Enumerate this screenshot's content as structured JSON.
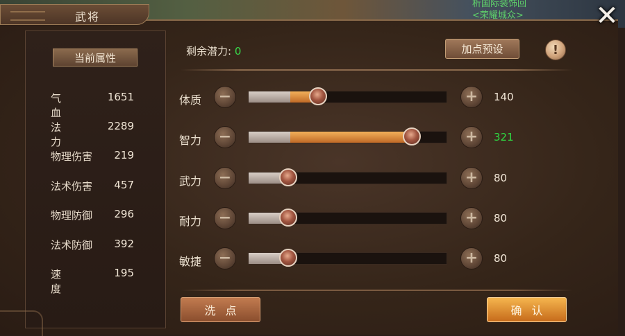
{
  "background": {
    "line1": "析国际装饰回",
    "line2": "<荣耀城众>"
  },
  "window": {
    "title": "武将"
  },
  "left": {
    "header": "当前属性",
    "stats": [
      {
        "label": "气血",
        "value": "1651"
      },
      {
        "label": "法力",
        "value": "2289"
      },
      {
        "label": "物理伤害",
        "value": "219"
      },
      {
        "label": "法术伤害",
        "value": "457"
      },
      {
        "label": "物理防御",
        "value": "296"
      },
      {
        "label": "法术防御",
        "value": "392"
      },
      {
        "label": "速度",
        "value": "195"
      }
    ]
  },
  "right": {
    "remaining_label": "剩余潜力:",
    "remaining_value": "0",
    "preset_button": "加点预设",
    "info_icon_glyph": "!",
    "minus_glyph": "−",
    "plus_glyph": "+",
    "sliders": [
      {
        "name": "体质",
        "value": "140",
        "base_fraction": 0.21,
        "current_fraction": 0.35,
        "highlight": false
      },
      {
        "name": "智力",
        "value": "321",
        "base_fraction": 0.21,
        "current_fraction": 0.82,
        "highlight": true
      },
      {
        "name": "武力",
        "value": "80",
        "base_fraction": 0.2,
        "current_fraction": 0.2,
        "highlight": false
      },
      {
        "name": "耐力",
        "value": "80",
        "base_fraction": 0.2,
        "current_fraction": 0.2,
        "highlight": false
      },
      {
        "name": "敏捷",
        "value": "80",
        "base_fraction": 0.2,
        "current_fraction": 0.2,
        "highlight": false
      }
    ],
    "reset_button": "洗点",
    "confirm_button": "确认"
  },
  "close_glyph": "✕",
  "colors": {
    "highlight_value": "#2fd842",
    "remaining_value": "#38d94a",
    "fill_added": "#e08a3a"
  }
}
